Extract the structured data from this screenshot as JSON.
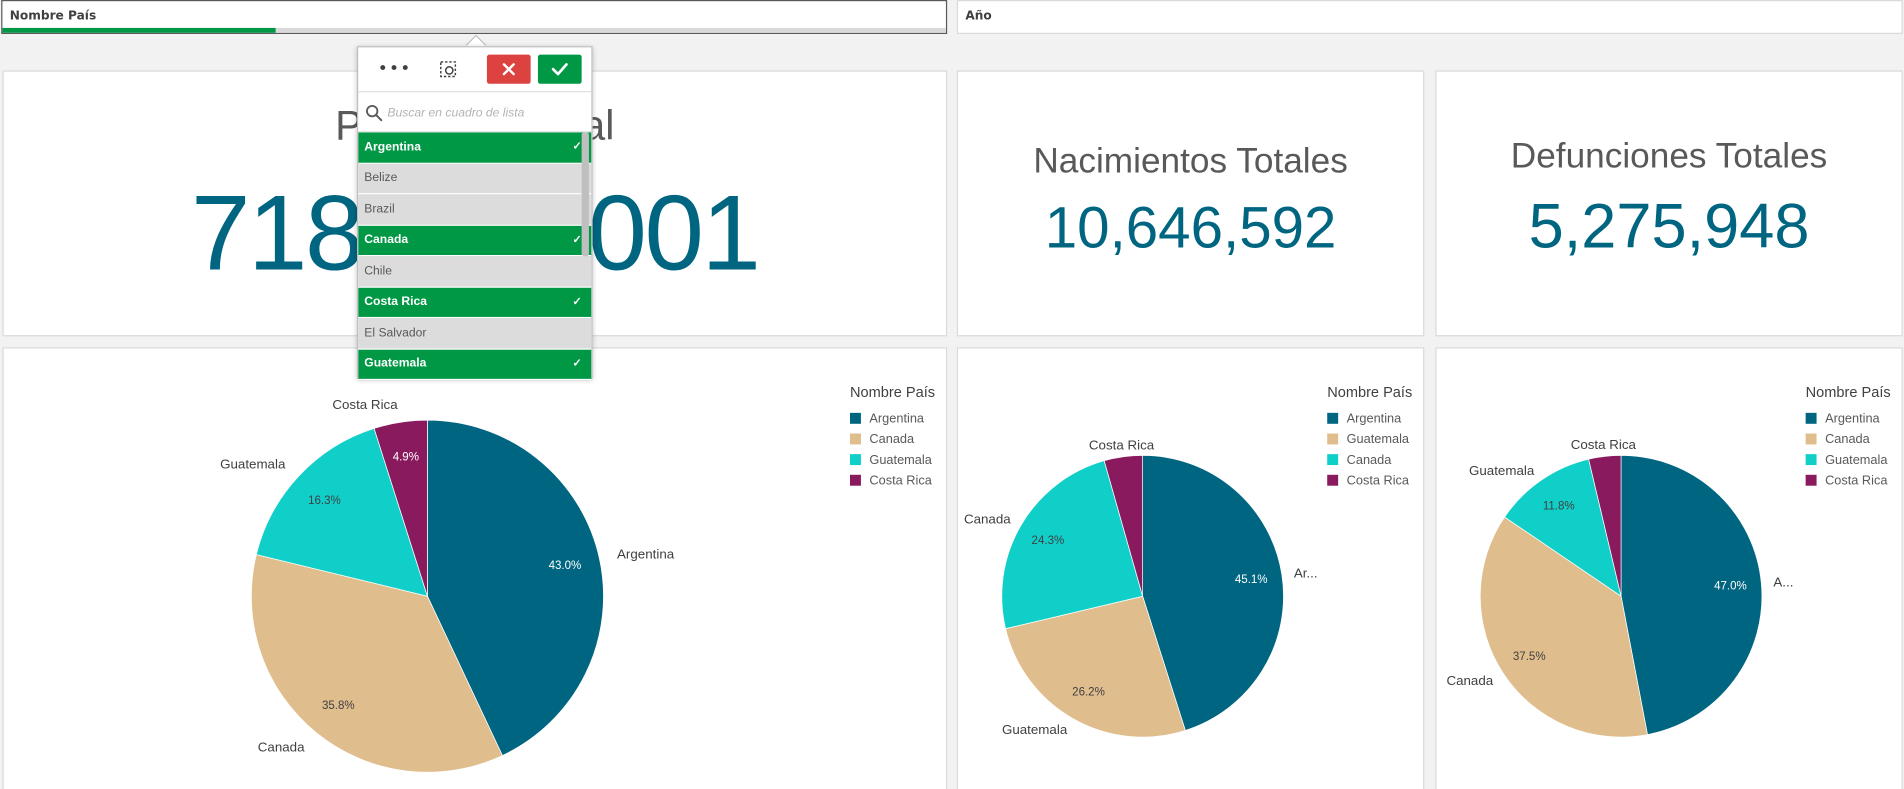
{
  "filters": [
    {
      "label": "Nombre País",
      "progress": 0.29
    },
    {
      "label": "Año"
    }
  ],
  "kpis": [
    {
      "title": "Población Total",
      "value": "718,593,001"
    },
    {
      "title": "Nacimientos Totales",
      "value": "10,646,592"
    },
    {
      "title": "Defunciones Totales",
      "value": "5,275,948"
    }
  ],
  "listbox": {
    "toolbar": {
      "more_icon": "ellipsis-icon",
      "selection_tool_icon": "lasso-select-icon",
      "cancel_icon": "close-icon",
      "confirm_icon": "checkmark-icon"
    },
    "search_placeholder": "Buscar en cuadro de lista",
    "items": [
      {
        "label": "Argentina",
        "state": "selected"
      },
      {
        "label": "Belize",
        "state": "alternative"
      },
      {
        "label": "Brazil",
        "state": "alternative"
      },
      {
        "label": "Canada",
        "state": "selected"
      },
      {
        "label": "Chile",
        "state": "alternative"
      },
      {
        "label": "Costa Rica",
        "state": "selected"
      },
      {
        "label": "El Salvador",
        "state": "alternative"
      },
      {
        "label": "Guatemala",
        "state": "selected"
      }
    ]
  },
  "colors": {
    "selected": "#009845",
    "kpi_value": "#006580",
    "cancel": "#dc423f",
    "confirm": "#009845"
  },
  "chart_data": [
    {
      "type": "pie",
      "legend_title": "Nombre País",
      "legend": [
        "Argentina",
        "Canada",
        "Guatemala",
        "Costa Rica"
      ],
      "slices": [
        {
          "label": "Argentina",
          "value": 43.0,
          "pct": "43.0%",
          "color": "#006580"
        },
        {
          "label": "Canada",
          "value": 35.8,
          "pct": "35.8%",
          "color": "#e0bd8d"
        },
        {
          "label": "Guatemala",
          "value": 16.3,
          "pct": "16.3%",
          "color": "#10cfc9"
        },
        {
          "label": "Costa Rica",
          "value": 4.9,
          "pct": "4.9%",
          "color": "#8a1a5e"
        }
      ]
    },
    {
      "type": "pie",
      "legend_title": "Nombre País",
      "legend": [
        "Argentina",
        "Guatemala",
        "Canada",
        "Costa Rica"
      ],
      "slices": [
        {
          "label": "Ar...",
          "value": 45.1,
          "pct": "45.1%",
          "color": "#006580"
        },
        {
          "label": "Guatemala",
          "value": 26.2,
          "pct": "26.2%",
          "color": "#e0bd8d"
        },
        {
          "label": "Canada",
          "value": 24.3,
          "pct": "24.3%",
          "color": "#10cfc9"
        },
        {
          "label": "Costa Rica",
          "value": 4.4,
          "pct": "",
          "color": "#8a1a5e"
        }
      ]
    },
    {
      "type": "pie",
      "legend_title": "Nombre País",
      "legend": [
        "Argentina",
        "Canada",
        "Guatemala",
        "Costa Rica"
      ],
      "slices": [
        {
          "label": "A...",
          "value": 47.0,
          "pct": "47.0%",
          "color": "#006580"
        },
        {
          "label": "Canada",
          "value": 37.5,
          "pct": "37.5%",
          "color": "#e0bd8d"
        },
        {
          "label": "Guatemala",
          "value": 11.8,
          "pct": "11.8%",
          "color": "#10cfc9"
        },
        {
          "label": "Costa Rica",
          "value": 3.7,
          "pct": "",
          "color": "#8a1a5e"
        }
      ]
    }
  ]
}
